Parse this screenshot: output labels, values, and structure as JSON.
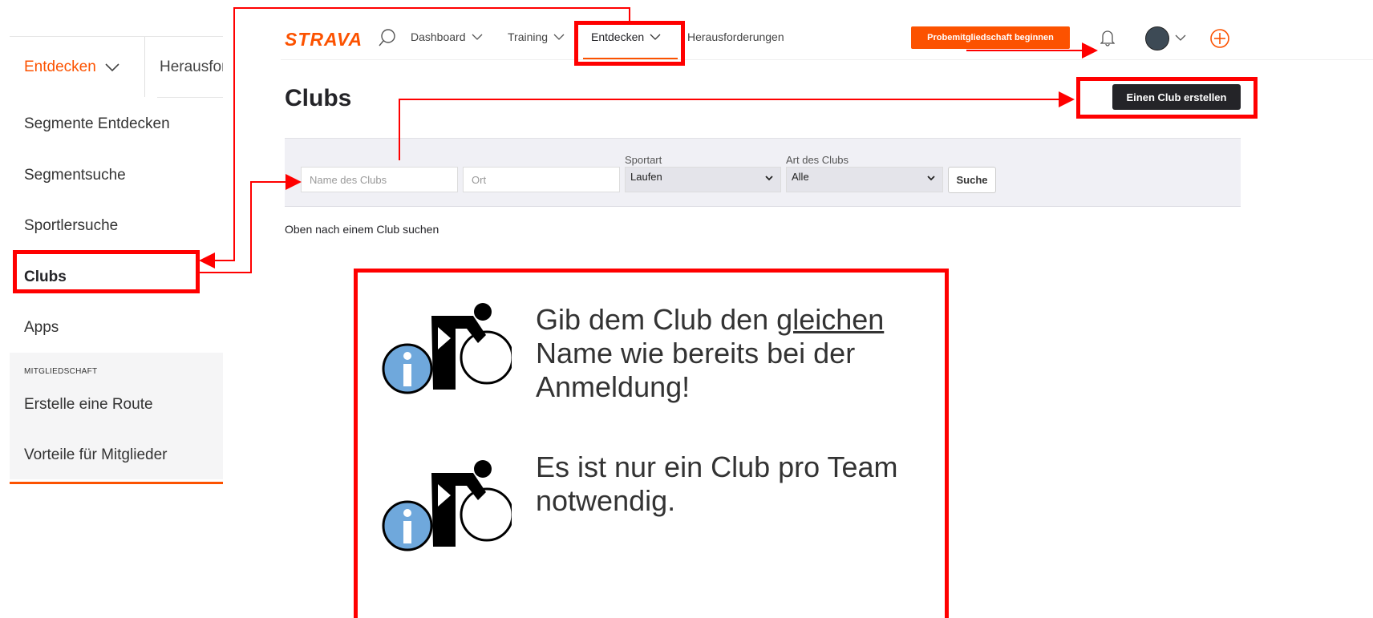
{
  "dropdown": {
    "active_tab": "Entdecken",
    "next_tab": "Herausforderungen",
    "items": [
      "Segmente Entdecken",
      "Segmentsuche",
      "Sportlersuche",
      "Clubs",
      "Apps"
    ],
    "section_label": "MITGLIEDSCHAFT",
    "section_items": [
      "Erstelle eine Route",
      "Vorteile für Mitglieder"
    ]
  },
  "header": {
    "logo": "STRAVA",
    "nav": [
      "Dashboard",
      "Training",
      "Entdecken",
      "Herausforderungen"
    ],
    "trial_button": "Probemitgliedschaft beginnen"
  },
  "page": {
    "title": "Clubs",
    "create_button": "Einen Club erstellen",
    "filters": {
      "name_placeholder": "Name des Clubs",
      "location_placeholder": "Ort",
      "sport_label": "Sportart",
      "sport_value": "Laufen",
      "type_label": "Art des Clubs",
      "type_value": "Alle",
      "search_button": "Suche"
    },
    "hint": "Oben nach einem Club suchen"
  },
  "info": {
    "line1_pre": "Gib dem Club den ",
    "line1_underlined": "gleichen",
    "line2": "Name wie bereits bei der",
    "line3": "Anmeldung!",
    "note_line1": "Es ist nur ein Club pro Team",
    "note_line2": "notwendig."
  },
  "colors": {
    "brand": "#fc5200",
    "annotation": "#ff0000",
    "info_icon": "#6fa8dc"
  },
  "icons": [
    "search-icon",
    "chevron-down-icon",
    "bell-icon",
    "avatar",
    "plus-circle-icon",
    "cyclist-info-icon"
  ]
}
